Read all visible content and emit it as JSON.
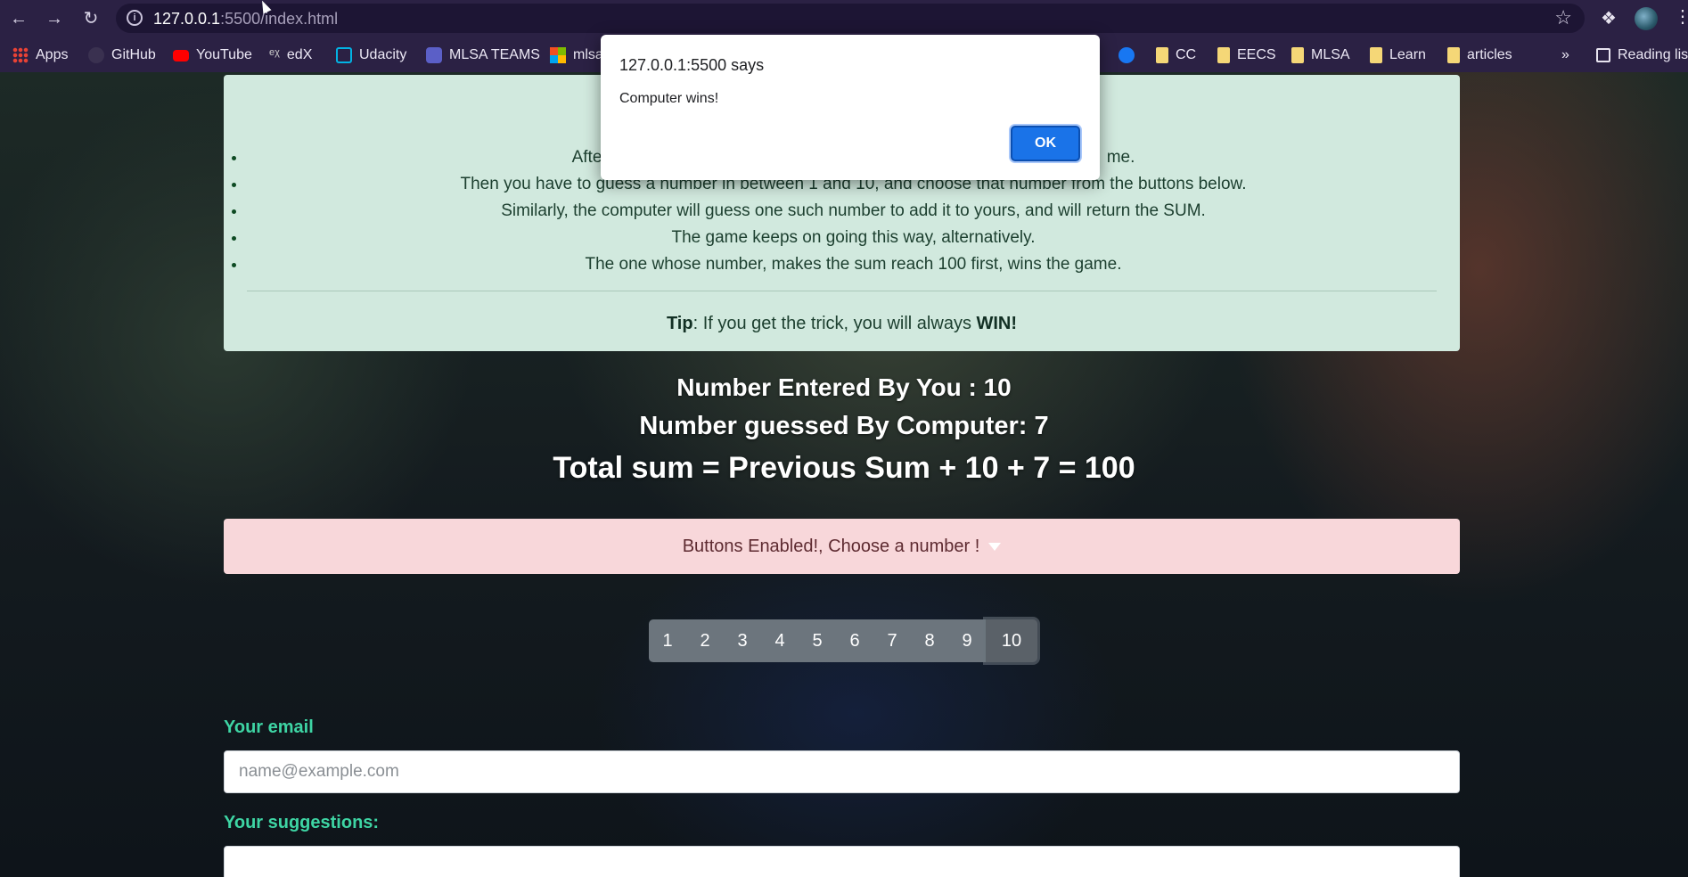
{
  "browser": {
    "url_host": "127.0.0.1",
    "url_rest": ":5500/index.html",
    "bookmarks": [
      {
        "label": "Apps"
      },
      {
        "label": "GitHub"
      },
      {
        "label": "YouTube"
      },
      {
        "label": "edX"
      },
      {
        "label": "Udacity"
      },
      {
        "label": "MLSA TEAMS"
      },
      {
        "label": "mlsa"
      },
      {
        "label": "CC"
      },
      {
        "label": "EECS"
      },
      {
        "label": "MLSA"
      },
      {
        "label": "Learn"
      },
      {
        "label": "articles"
      }
    ],
    "more_label": "»",
    "reading_list": "Reading list"
  },
  "rules": {
    "items": [
      "After",
      "Then you have to guess a number in between 1 and 10, and choose that number from the buttons below.",
      "Similarly, the computer will guess one such number to add it to yours, and will return the SUM.",
      "The game keeps on going this way, alternatively.",
      "The one whose number, makes the sum reach 100 first, wins the game."
    ],
    "item0_tail": "me.",
    "tip_label": "Tip",
    "tip_text": ": If you get the trick, you will always ",
    "tip_win": "WIN!"
  },
  "result": {
    "user_line": "Number Entered By You : 10",
    "computer_line": "Number guessed By Computer: 7",
    "total_line": "Total sum = Previous Sum + 10 + 7 = 100"
  },
  "status": {
    "text": "Buttons Enabled!, Choose a number !"
  },
  "number_buttons": [
    "1",
    "2",
    "3",
    "4",
    "5",
    "6",
    "7",
    "8",
    "9",
    "10"
  ],
  "form": {
    "email_label": "Your email",
    "email_placeholder": "name@example.com",
    "suggestions_label": "Your suggestions:"
  },
  "alert": {
    "title": "127.0.0.1:5500 says",
    "message": "Computer wins!",
    "ok_label": "OK"
  }
}
